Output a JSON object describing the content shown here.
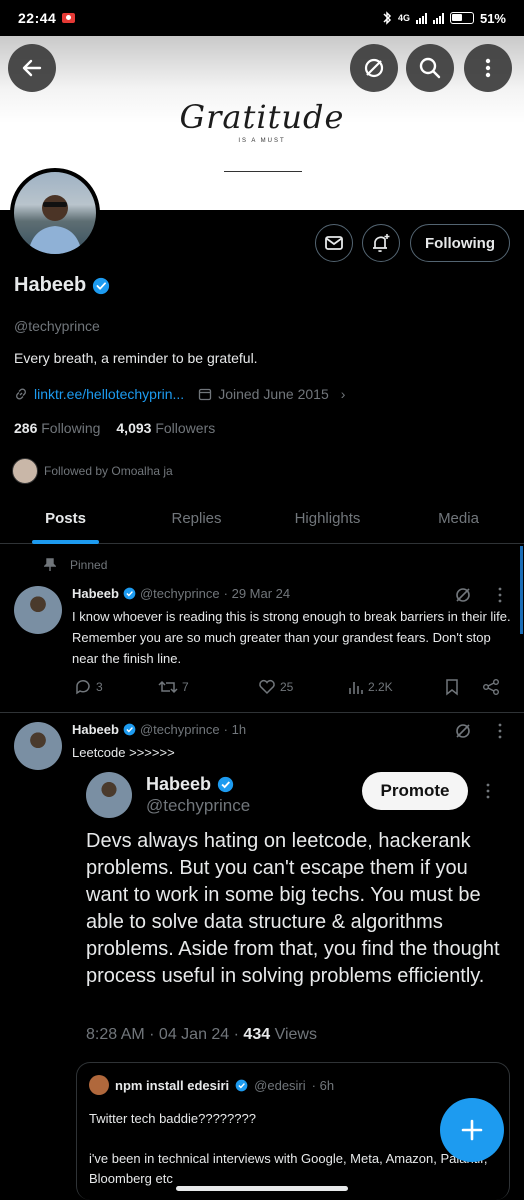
{
  "status_bar": {
    "time": "22:44",
    "network": "4G",
    "battery": "51%"
  },
  "banner": {
    "title": "Gratitude",
    "subtitle": "IS A MUST"
  },
  "header_buttons": [
    "back",
    "block",
    "search",
    "more"
  ],
  "profile": {
    "name": "Habeeb",
    "handle": "@techyprince",
    "bio": "Every breath, a reminder to be grateful.",
    "link": "linktr.ee/hellotechyprin...",
    "joined": "Joined June 2015",
    "following_count": "286",
    "following_label": "Following",
    "followers_count": "4,093",
    "followers_label": "Followers",
    "followed_by": "Followed by Omoalha ja",
    "follow_button": "Following"
  },
  "tabs": [
    "Posts",
    "Replies",
    "Highlights",
    "Media"
  ],
  "pinned_label": "Pinned",
  "posts": [
    {
      "name": "Habeeb",
      "handle": "@techyprince",
      "time": "· 29 Mar 24",
      "text": "I know whoever is reading this is strong enough to break barriers in their life. Remember you are so much greater than your grandest fears. Don't stop near the finish line.",
      "replies": "3",
      "reposts": "7",
      "likes": "25",
      "views": "2.2K"
    },
    {
      "name": "Habeeb",
      "handle": "@techyprince",
      "time": "· 1h",
      "text": "Leetcode >>>>>>"
    }
  ],
  "quoted": {
    "name": "Habeeb",
    "handle": "@techyprince",
    "promote_label": "Promote",
    "text": "Devs always hating on leetcode, hackerank problems. But you can't escape them if you want to work in some big techs. You must be able to solve data structure & algorithms problems. Aside from that, you find the thought process useful in solving problems efficiently.",
    "time": "8:28 AM · 04 Jan 24 · ",
    "views_count": "434",
    "views_label": " Views"
  },
  "inner_quote": {
    "name": "npm install edesiri",
    "handle": "@edesiri",
    "time": "· 6h",
    "line1": "Twitter tech baddie????????",
    "line2": "i've been in technical interviews with Google, Meta, Amazon, Palantir, Bloomberg etc"
  },
  "colors": {
    "accent": "#1d9bf0",
    "background": "#000000",
    "muted": "#71767b",
    "text": "#e7e9ea"
  }
}
